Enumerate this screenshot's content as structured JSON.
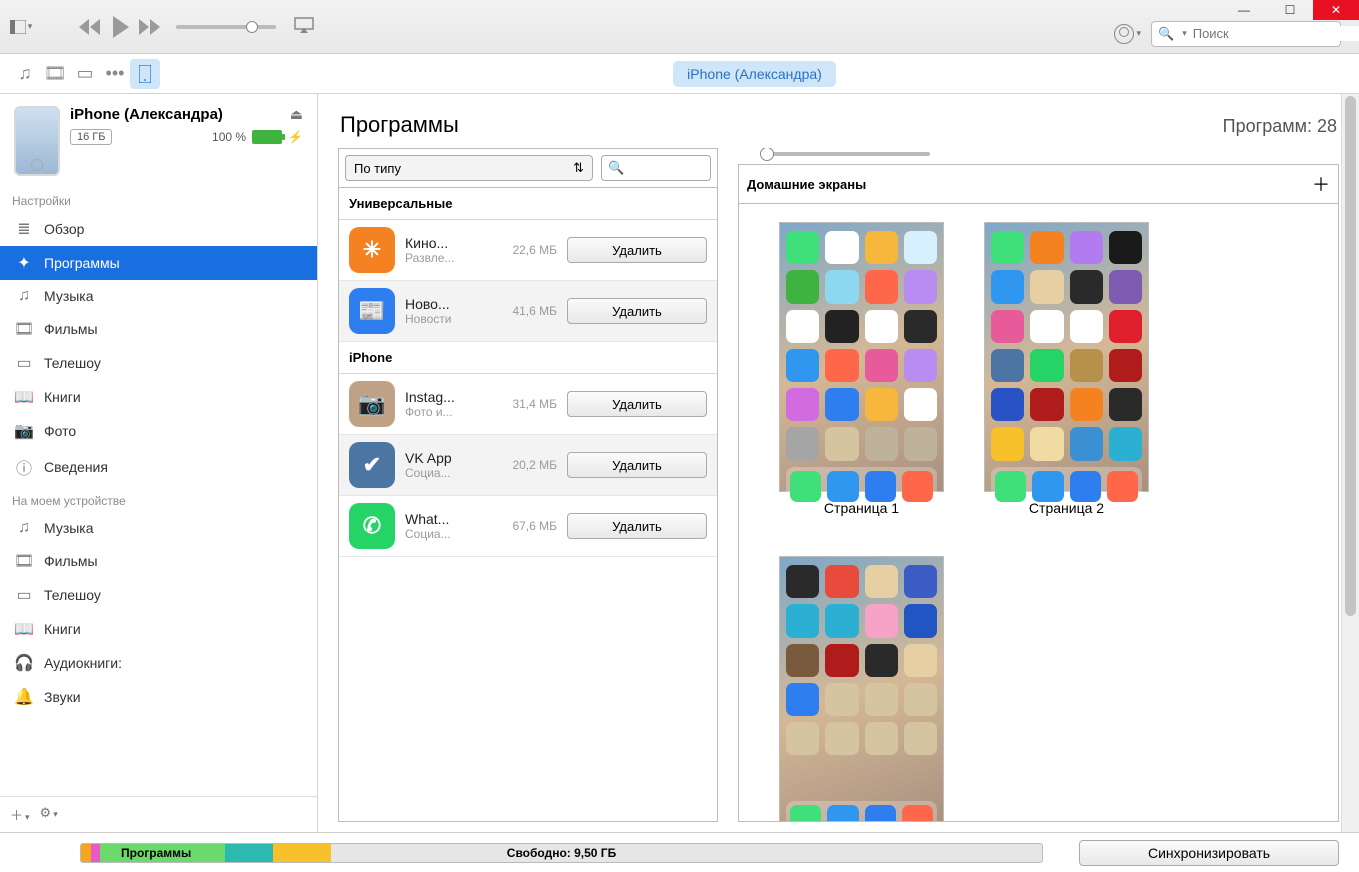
{
  "window": {
    "minimize": "—",
    "maximize": "☐",
    "close": "✕"
  },
  "search": {
    "placeholder": "Поиск"
  },
  "device_pill": "iPhone (Александра)",
  "device": {
    "name": "iPhone (Александра)",
    "capacity": "16 ГБ",
    "battery_pct": "100 %"
  },
  "sidebar": {
    "settings_header": "Настройки",
    "settings": [
      {
        "icon": "≣",
        "label": "Обзор"
      },
      {
        "icon": "✦",
        "label": "Программы"
      },
      {
        "icon": "♫",
        "label": "Музыка"
      },
      {
        "icon": "🎞",
        "label": "Фильмы"
      },
      {
        "icon": "▭",
        "label": "Телешоу"
      },
      {
        "icon": "📖",
        "label": "Книги"
      },
      {
        "icon": "📷",
        "label": "Фото"
      },
      {
        "icon": "ⓘ",
        "label": "Сведения"
      }
    ],
    "on_device_header": "На моем устройстве",
    "on_device": [
      {
        "icon": "♫",
        "label": "Музыка"
      },
      {
        "icon": "🎞",
        "label": "Фильмы"
      },
      {
        "icon": "▭",
        "label": "Телешоу"
      },
      {
        "icon": "📖",
        "label": "Книги"
      },
      {
        "icon": "🎧",
        "label": "Аудиокниги:"
      },
      {
        "icon": "🔔",
        "label": "Звуки"
      }
    ]
  },
  "content": {
    "title": "Программы",
    "count_label": "Программ: 28",
    "sort": "По типу",
    "groups": [
      {
        "header": "Универсальные",
        "apps": [
          {
            "name": "Кино...",
            "cat": "Развле...",
            "size": "22,6 МБ",
            "color": "#f58220",
            "glyph": "✳"
          },
          {
            "name": "Ново...",
            "cat": "Новости",
            "size": "41,6 МБ",
            "color": "#2f7ef0",
            "glyph": "📰"
          }
        ]
      },
      {
        "header": "iPhone",
        "apps": [
          {
            "name": "Instag...",
            "cat": "Фото и...",
            "size": "31,4 МБ",
            "color": "#bfa285",
            "glyph": "📷"
          },
          {
            "name": "VK App",
            "cat": "Социа...",
            "size": "20,2 МБ",
            "color": "#4c75a3",
            "glyph": "✔"
          },
          {
            "name": "What...",
            "cat": "Социа...",
            "size": "67,6 МБ",
            "color": "#25d366",
            "glyph": "✆"
          }
        ]
      }
    ],
    "delete_label": "Удалить",
    "home_screens_header": "Домашние экраны",
    "screens": [
      {
        "label": "Страница 1"
      },
      {
        "label": "Страница 2"
      },
      {
        "label": ""
      }
    ]
  },
  "bottom": {
    "segments": [
      {
        "color": "#f7a51c",
        "w": "1%"
      },
      {
        "color": "#e85bc7",
        "w": "1%"
      },
      {
        "color": "#6cd96c",
        "w": "13%"
      },
      {
        "color": "#2bb9b0",
        "w": "5%"
      },
      {
        "color": "#f7c12b",
        "w": "6%"
      }
    ],
    "seg_label": "Программы",
    "free": "Свободно: 9,50 ГБ",
    "sync": "Синхронизировать"
  },
  "mini_palettes": {
    "p1": [
      "#3fe07a",
      "#fff",
      "#f7b73c",
      "#d7f0ff",
      "#3fb33f",
      "#8bd8f0",
      "#ff674b",
      "#b88cf0",
      "#fff",
      "#222",
      "#fff",
      "#2a2a2a",
      "#2f97f0",
      "#ff674b",
      "#e85b9b",
      "#b88cf0",
      "#d26be0",
      "#2f7ef0",
      "#f7b73c",
      "#fff",
      "#a5a5a5",
      "#d4c4a0",
      "#bfb29a",
      "#bfb29a"
    ],
    "p2": [
      "#3fe07a",
      "#f58220",
      "#b37bf0",
      "#1a1a1a",
      "#2f97f0",
      "#e6cfa3",
      "#2a2a2a",
      "#7d5bb0",
      "#e85b9b",
      "#fff",
      "#fff",
      "#e01f2d",
      "#4c75a3",
      "#25d366",
      "#b5914a",
      "#b01c1c",
      "#2952c4",
      "#b01c1c",
      "#f58220",
      "#2a2a2a",
      "#f7c12b",
      "#f0dca3",
      "#3b90d4",
      "#2bb0d4"
    ],
    "p3": [
      "#2a2a2a",
      "#e84b3c",
      "#e6cfa3",
      "#3b5cc4",
      "#2bb0d4",
      "#2bb0d4",
      "#f7a3c7",
      "#2255c4",
      "#7a5a3c",
      "#b01c1c",
      "#2a2a2a",
      "#e6cfa3",
      "#2f7ef0",
      "#d4c4a0",
      "#d4c4a0",
      "#d4c4a0",
      "#d4c4a0",
      "#d4c4a0",
      "#d4c4a0",
      "#d4c4a0"
    ],
    "dock": [
      "#3fe07a",
      "#2f97f0",
      "#2f7ef0",
      "#ff674b"
    ]
  }
}
